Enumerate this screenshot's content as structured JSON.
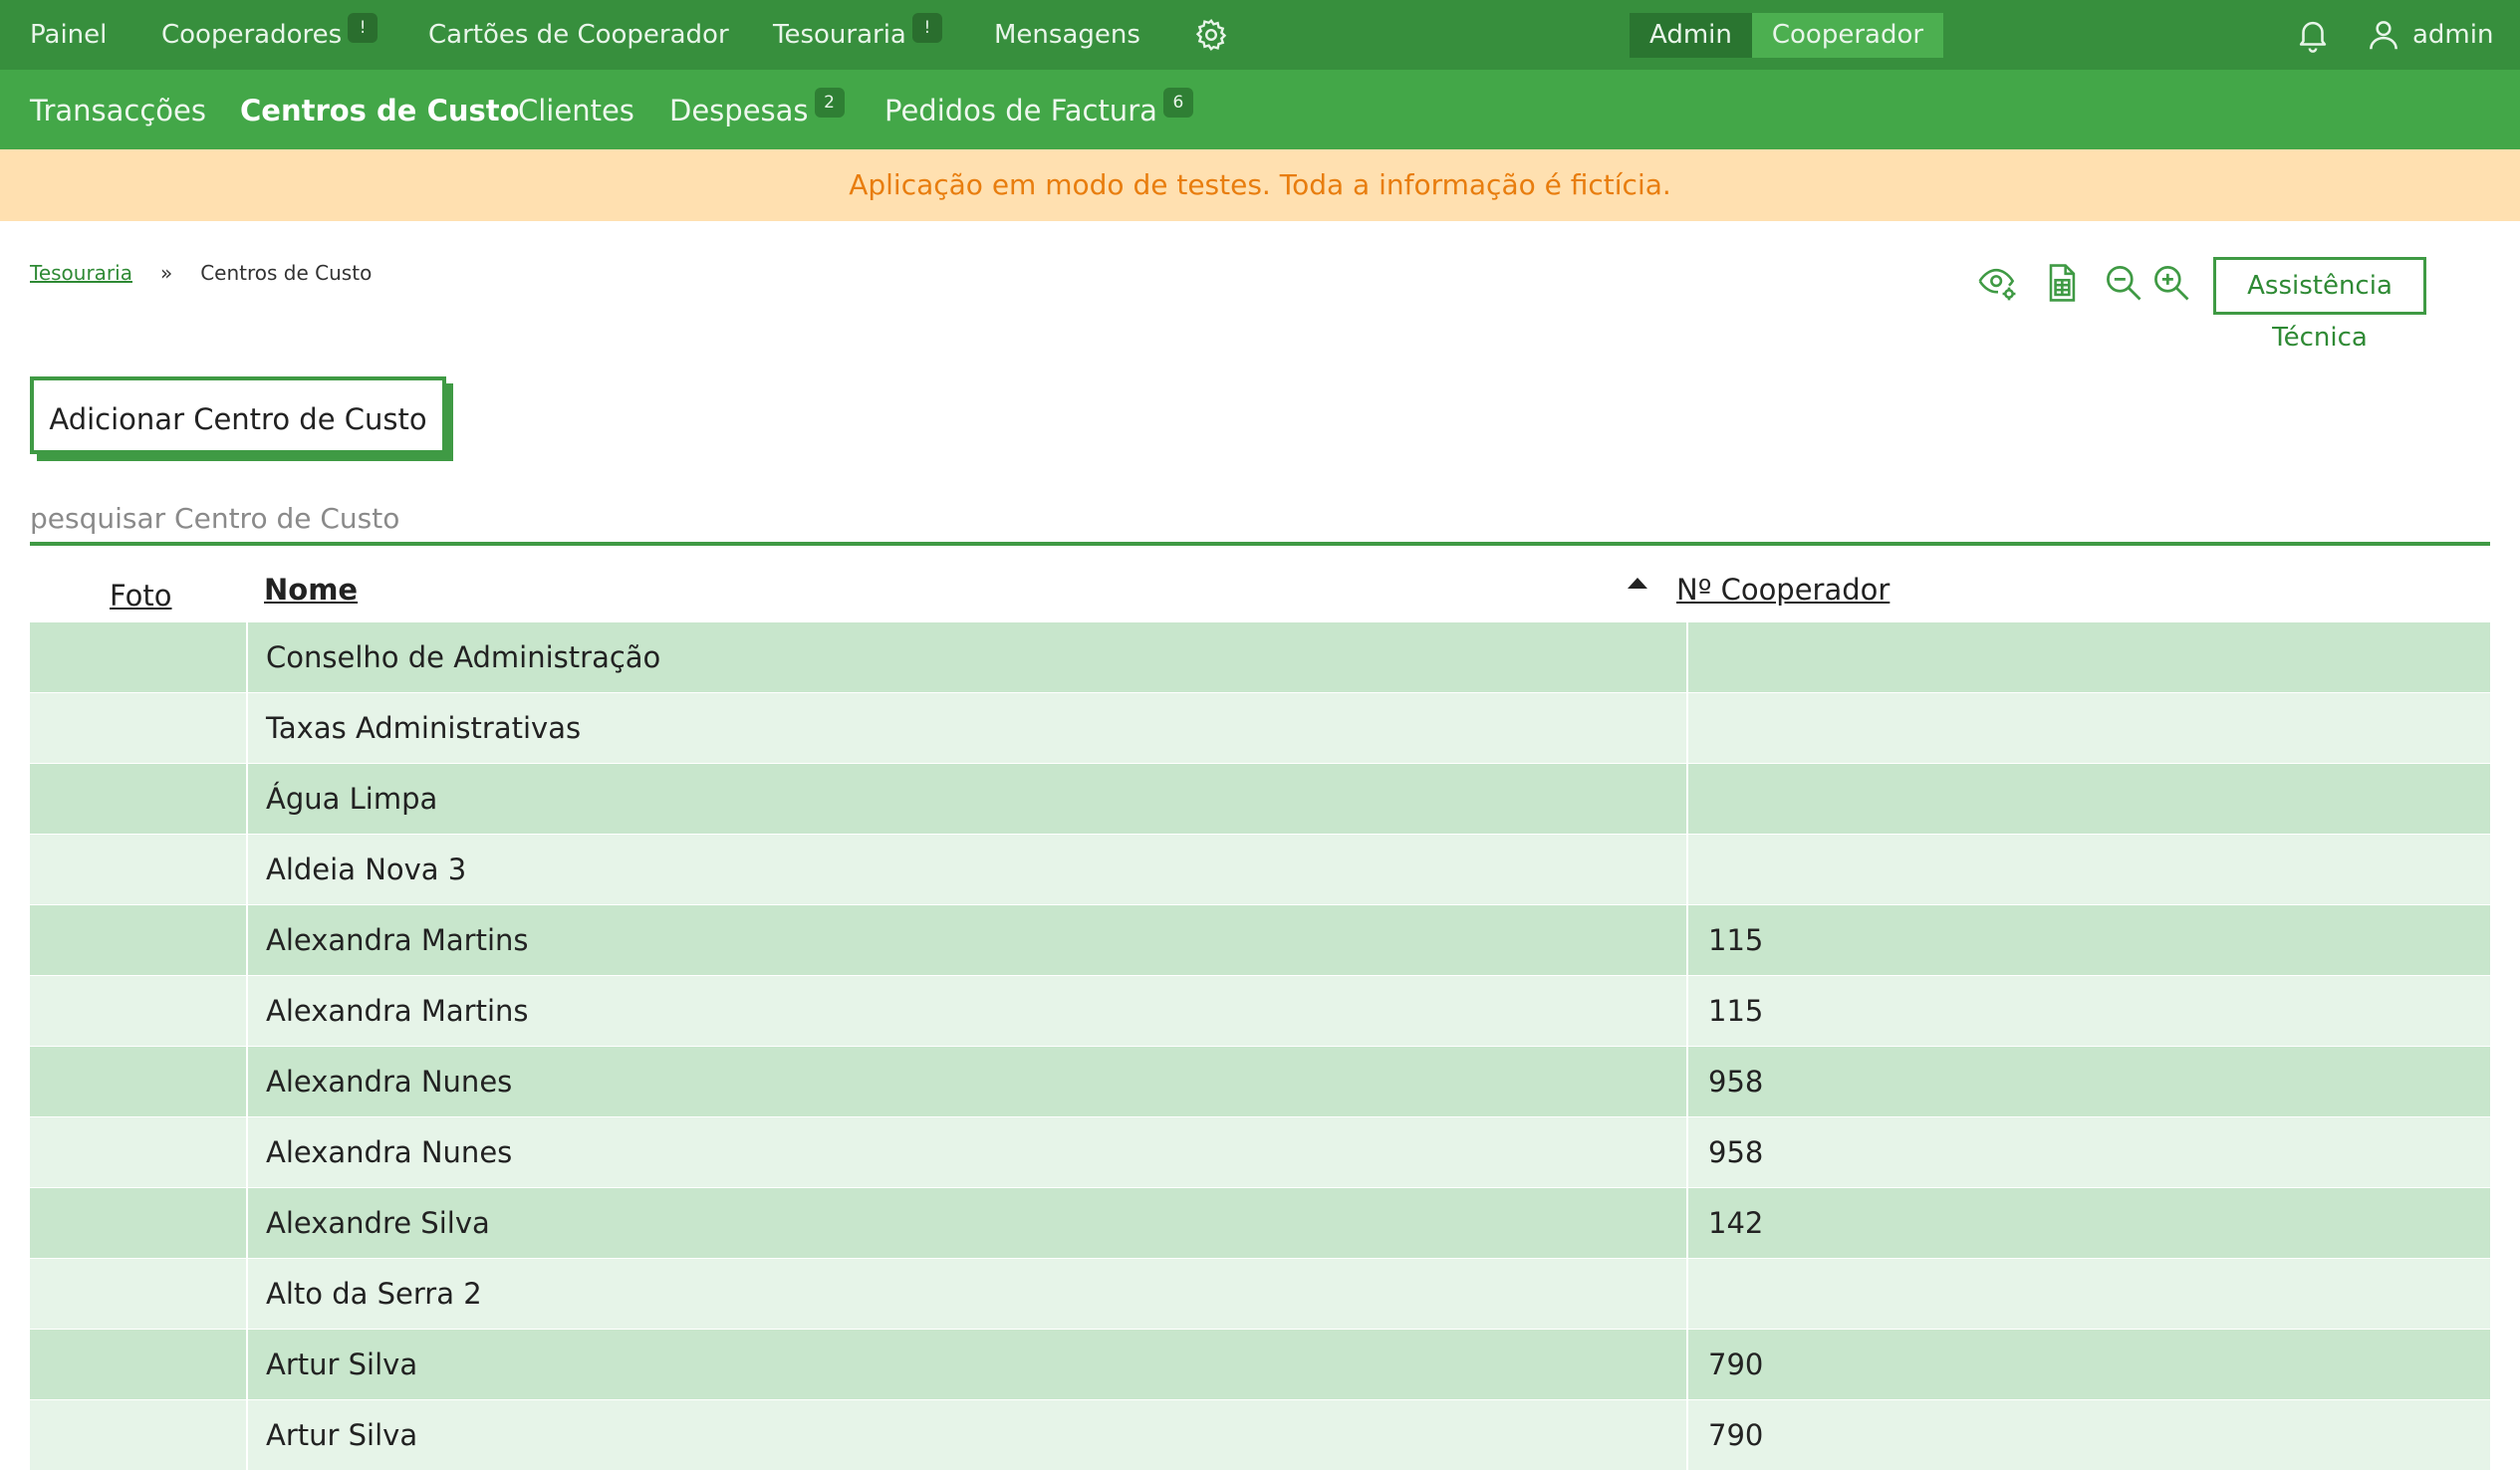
{
  "topbar": {
    "items": [
      {
        "label": "Painel"
      },
      {
        "label": "Cooperadores",
        "badge": "!"
      },
      {
        "label": "Cartões de Cooperador"
      },
      {
        "label": "Tesouraria",
        "badge": "!"
      },
      {
        "label": "Mensagens"
      }
    ],
    "settings_icon": "gear-icon",
    "roles": {
      "admin": "Admin",
      "cooperador": "Cooperador",
      "selected": "Admin"
    },
    "notifications_icon": "bell-icon",
    "user_icon": "user-icon",
    "username": "admin"
  },
  "subnav": {
    "items": [
      {
        "label": "Transacções"
      },
      {
        "label": "Centros de Custo",
        "active": true
      },
      {
        "label": "Clientes"
      },
      {
        "label": "Despesas",
        "badge": "2"
      },
      {
        "label": "Pedidos de Factura",
        "badge": "6"
      }
    ]
  },
  "banner": {
    "text": "Aplicação em modo de testes. Toda a informação é fictícia."
  },
  "breadcrumb": {
    "parent": "Tesouraria",
    "separator": "»",
    "current": "Centros de Custo"
  },
  "toolbar": {
    "icons": [
      "eye-settings-icon",
      "spreadsheet-icon",
      "zoom-out-icon",
      "zoom-in-icon"
    ],
    "support_label": "Assistência Técnica"
  },
  "actions": {
    "add_label": "Adicionar Centro de Custo"
  },
  "search": {
    "placeholder": "pesquisar Centro de Custo",
    "value": ""
  },
  "table": {
    "columns": {
      "foto": "Foto",
      "nome": "Nome",
      "numero": "Nº Cooperador"
    },
    "sort": {
      "column": "Nome",
      "direction": "ascending"
    },
    "rows": [
      {
        "nome": "Conselho de Administração",
        "numero": ""
      },
      {
        "nome": "Taxas Administrativas",
        "numero": ""
      },
      {
        "nome": "Água Limpa",
        "numero": ""
      },
      {
        "nome": "Aldeia Nova 3",
        "numero": ""
      },
      {
        "nome": "Alexandra Martins",
        "numero": "115"
      },
      {
        "nome": "Alexandra Martins",
        "numero": "115"
      },
      {
        "nome": "Alexandra Nunes",
        "numero": "958"
      },
      {
        "nome": "Alexandra Nunes",
        "numero": "958"
      },
      {
        "nome": "Alexandre Silva",
        "numero": "142"
      },
      {
        "nome": "Alto da Serra 2",
        "numero": ""
      },
      {
        "nome": "Artur Silva",
        "numero": "790"
      },
      {
        "nome": "Artur Silva",
        "numero": "790"
      }
    ]
  },
  "colors": {
    "topbar": "#378f3d",
    "subnav": "#43a748",
    "accent": "#3f9a44",
    "banner_bg": "#ffe0b0",
    "banner_text": "#e87d0e",
    "row_odd": "#c8e6cc",
    "row_even": "#e6f4e8"
  }
}
